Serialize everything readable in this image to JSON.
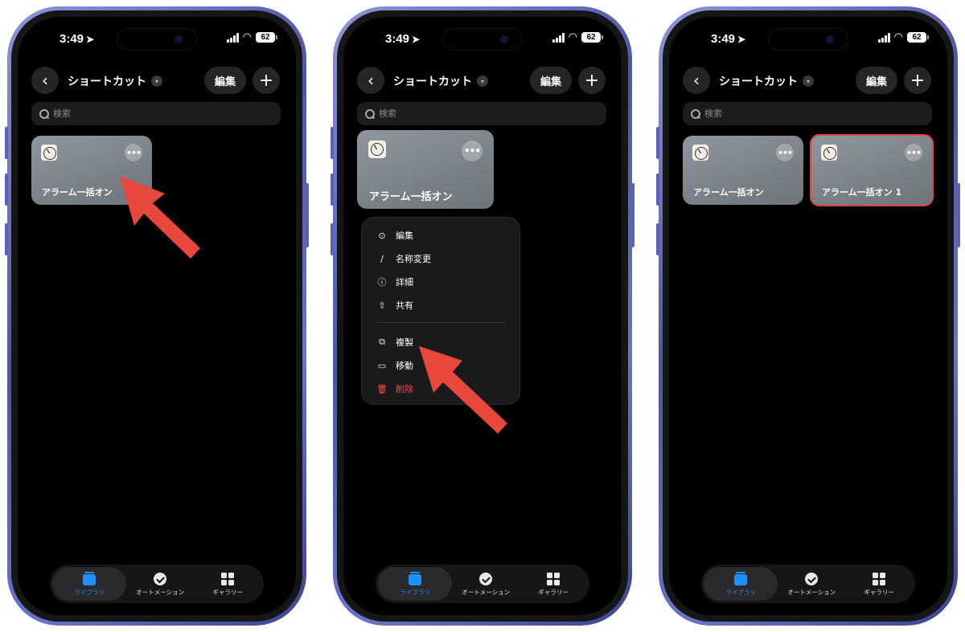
{
  "status": {
    "time": "3:49",
    "battery": "62"
  },
  "nav": {
    "title": "ショートカット",
    "edit_label": "編集"
  },
  "search": {
    "placeholder": "検索"
  },
  "cards": {
    "original": "アラーム一括オン",
    "duplicate": "アラーム一括オン 1"
  },
  "menu": {
    "items": [
      {
        "label": "編集",
        "icon": "ellipsis-circle-icon"
      },
      {
        "label": "名称変更",
        "icon": "pencil-icon"
      },
      {
        "label": "詳細",
        "icon": "info-icon"
      },
      {
        "label": "共有",
        "icon": "share-icon"
      },
      {
        "label": "複製",
        "icon": "duplicate-icon"
      },
      {
        "label": "移動",
        "icon": "folder-icon"
      },
      {
        "label": "削除",
        "icon": "trash-icon"
      }
    ]
  },
  "tabs": [
    {
      "label": "ライブラリ",
      "icon": "library-icon",
      "active": true
    },
    {
      "label": "オートメーション",
      "icon": "automation-icon",
      "active": false
    },
    {
      "label": "ギャラリー",
      "icon": "gallery-icon",
      "active": false
    }
  ],
  "colors": {
    "accent": "#1e90ff",
    "arrow": "#e8473b",
    "danger": "#ff453a",
    "phone_frame": "#5a62b4"
  }
}
